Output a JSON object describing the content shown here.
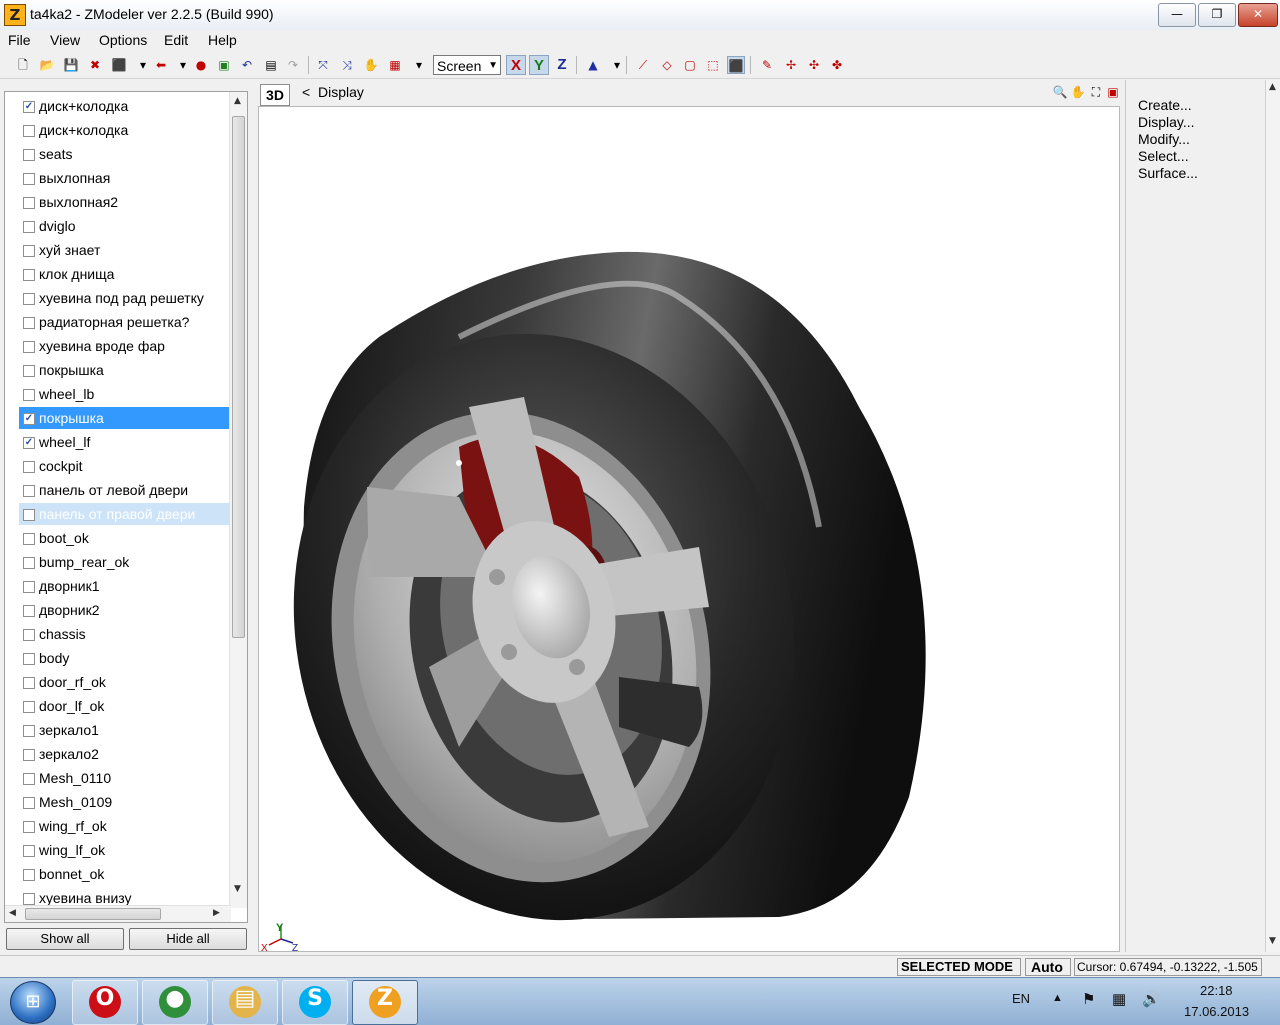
{
  "window": {
    "title": "ta4ka2 - ZModeler ver 2.2.5 (Build 990)",
    "app_icon": "Z",
    "minimize": "—",
    "maximize": "❐",
    "close": "✕"
  },
  "menu": [
    "File",
    "View",
    "Options",
    "Edit",
    "Help"
  ],
  "toolbar": {
    "view_select": "Screen",
    "axes": [
      "X",
      "Y",
      "Z"
    ]
  },
  "objects": {
    "items": [
      {
        "label": "диск+колодка",
        "checked": true
      },
      {
        "label": "диск+колодка",
        "checked": false
      },
      {
        "label": "seats",
        "checked": false
      },
      {
        "label": "выхлопная",
        "checked": false
      },
      {
        "label": "выхлопная2",
        "checked": false
      },
      {
        "label": "dviglo",
        "checked": false
      },
      {
        "label": "хуй знает",
        "checked": false
      },
      {
        "label": "клок днища",
        "checked": false
      },
      {
        "label": "хуевина под рад решетку",
        "checked": false
      },
      {
        "label": "радиаторная решетка?",
        "checked": false
      },
      {
        "label": "хуевина вроде фар",
        "checked": false
      },
      {
        "label": "покрышка",
        "checked": false
      },
      {
        "label": "wheel_lb",
        "checked": false
      },
      {
        "label": "покрышка",
        "checked": true,
        "state": "selected"
      },
      {
        "label": "wheel_lf",
        "checked": true
      },
      {
        "label": "cockpit",
        "checked": false
      },
      {
        "label": "панель от левой двери",
        "checked": false
      },
      {
        "label": "панель от правой двери",
        "checked": false,
        "state": "hover"
      },
      {
        "label": "boot_ok",
        "checked": false
      },
      {
        "label": "bump_rear_ok",
        "checked": false
      },
      {
        "label": "дворник1",
        "checked": false
      },
      {
        "label": "дворник2",
        "checked": false
      },
      {
        "label": "chassis",
        "checked": false
      },
      {
        "label": "body",
        "checked": false
      },
      {
        "label": "door_rf_ok",
        "checked": false
      },
      {
        "label": "door_lf_ok",
        "checked": false
      },
      {
        "label": "зеркало1",
        "checked": false
      },
      {
        "label": "зеркало2",
        "checked": false
      },
      {
        "label": "Mesh_0110",
        "checked": false
      },
      {
        "label": "Mesh_0109",
        "checked": false
      },
      {
        "label": "wing_rf_ok",
        "checked": false
      },
      {
        "label": "wing_lf_ok",
        "checked": false
      },
      {
        "label": "bonnet_ok",
        "checked": false
      },
      {
        "label": "хуевина внизу",
        "checked": false
      }
    ],
    "show_all": "Show all",
    "hide_all": "Hide all"
  },
  "viewport": {
    "mode": "3D",
    "nav_arrow": "<",
    "nav_label": "Display",
    "gizmo_y": "Y",
    "gizmo_x": "X",
    "gizmo_z": "Z"
  },
  "command_panel": [
    "Create...",
    "Display...",
    "Modify...",
    "Select...",
    "Surface..."
  ],
  "status": {
    "mode": "SELECTED MODE",
    "snap": "Auto",
    "cursor": "Cursor: 0.67494, -0.13222, -1.505"
  },
  "taskbar": {
    "language": "EN",
    "time": "22:18",
    "date": "17.06.2013",
    "apps": [
      {
        "name": "opera",
        "glyph": "O",
        "color": "#cc0f16"
      },
      {
        "name": "chrome",
        "glyph": "●",
        "color": "#2f8f3b"
      },
      {
        "name": "explorer",
        "glyph": "▤",
        "color": "#e2b44a"
      },
      {
        "name": "skype",
        "glyph": "S",
        "color": "#00aff0"
      },
      {
        "name": "zmodeler",
        "glyph": "Z",
        "color": "#f0a020"
      }
    ]
  },
  "colors": {
    "selection": "#3399ff",
    "brake_caliper": "#7a1212",
    "tire": "#2a2a2a",
    "rim": "#b9b9b9"
  }
}
